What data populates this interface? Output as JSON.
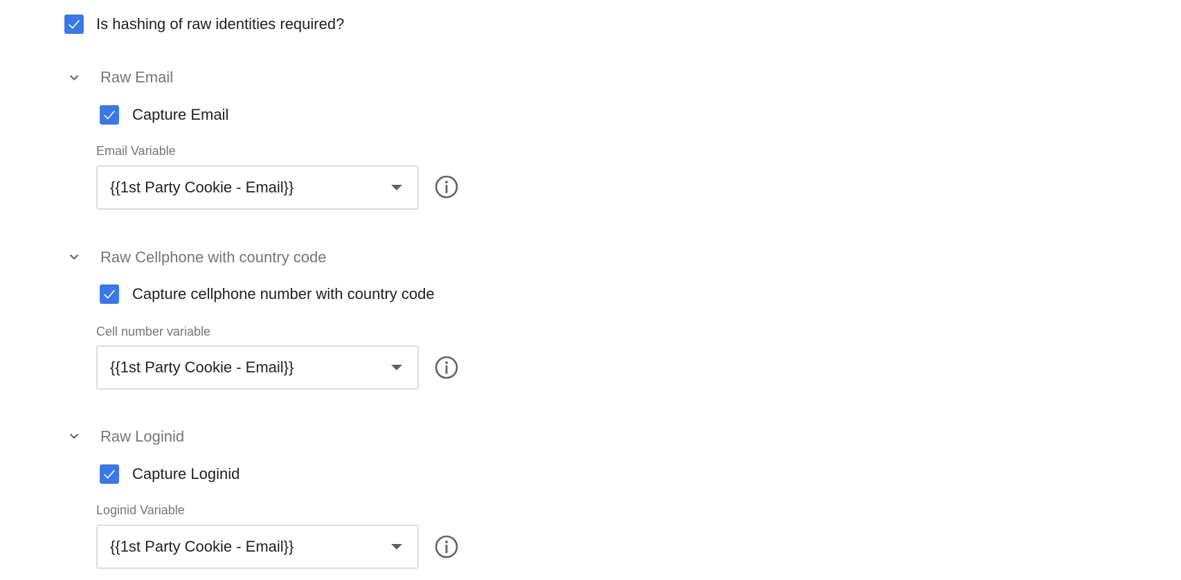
{
  "hashing": {
    "label": "Is hashing of raw identities required?",
    "checked": true
  },
  "sections": [
    {
      "title": "Raw Email",
      "checkbox_label": "Capture Email",
      "checked": true,
      "field_label": "Email Variable",
      "field_value": "{{1st Party Cookie - Email}}"
    },
    {
      "title": "Raw Cellphone with country code",
      "checkbox_label": "Capture cellphone number with country code",
      "checked": true,
      "field_label": "Cell number variable",
      "field_value": "{{1st Party Cookie - Email}}"
    },
    {
      "title": "Raw Loginid",
      "checkbox_label": "Capture Loginid",
      "checked": true,
      "field_label": "Loginid Variable",
      "field_value": "{{1st Party Cookie - Email}}"
    }
  ],
  "icons": {
    "checkbox": "checkmark-icon",
    "section_toggle": "chevron-down-icon",
    "help": "info-icon",
    "dropdown": "dropdown-arrow-icon"
  },
  "colors": {
    "checkbox_fill": "#3b78e7",
    "section_title": "#757575",
    "field_border": "#dadce0"
  }
}
